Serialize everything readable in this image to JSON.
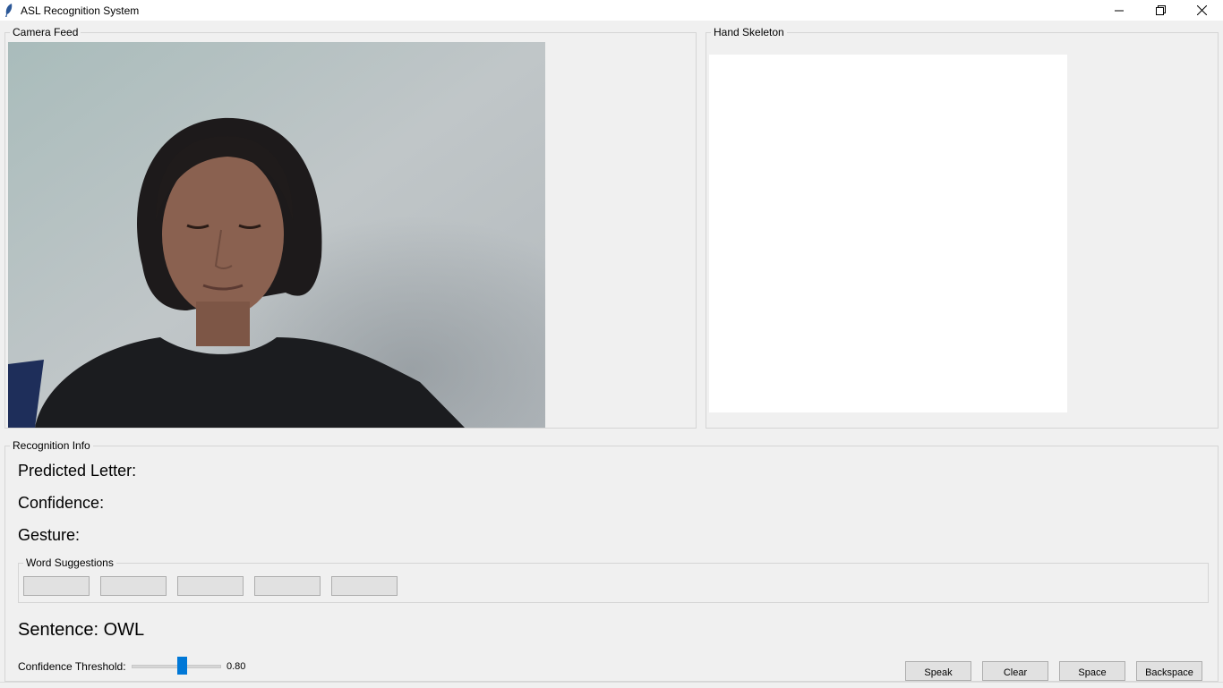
{
  "window": {
    "title": "ASL Recognition System",
    "minimize_glyph": "—",
    "restore_glyph": "❐",
    "close_glyph": "✕"
  },
  "camera": {
    "label": "Camera Feed"
  },
  "skeleton": {
    "label": "Hand Skeleton"
  },
  "recognition": {
    "label": "Recognition Info",
    "predicted_label": "Predicted Letter:",
    "confidence_label": "Confidence:",
    "gesture_label": "Gesture:",
    "suggestions_label": "Word Suggestions",
    "suggestions": [
      "",
      "",
      "",
      "",
      ""
    ],
    "sentence": "Sentence: OWL",
    "threshold_label": "Confidence Threshold:",
    "threshold_value": "0.80",
    "threshold_level": 0.8
  },
  "actions": {
    "speak": "Speak",
    "clear": "Clear",
    "space": "Space",
    "backspace": "Backspace"
  },
  "colors": {
    "accent": "#0078d7",
    "background": "#f0f0f0",
    "button": "#e1e1e1"
  }
}
